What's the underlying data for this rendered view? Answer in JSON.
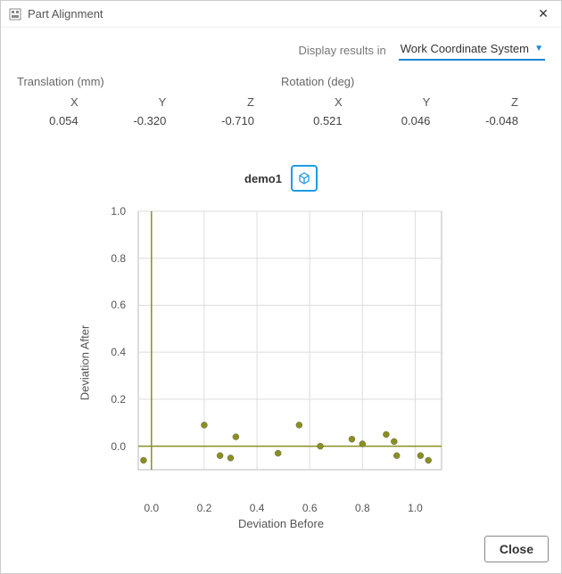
{
  "window": {
    "title": "Part Alignment"
  },
  "display": {
    "label": "Display results in",
    "selected": "Work Coordinate System"
  },
  "translation": {
    "header": "Translation (mm)",
    "x_label": "X",
    "y_label": "Y",
    "z_label": "Z",
    "x": "0.054",
    "y": "-0.320",
    "z": "-0.710"
  },
  "rotation": {
    "header": "Rotation (deg)",
    "x_label": "X",
    "y_label": "Y",
    "z_label": "Z",
    "x": "0.521",
    "y": "0.046",
    "z": "-0.048"
  },
  "legend": {
    "name": "demo1"
  },
  "footer": {
    "close": "Close"
  },
  "chart_data": {
    "type": "scatter",
    "title": "",
    "xlabel": "Deviation Before",
    "ylabel": "Deviation After",
    "xlim": [
      -0.05,
      1.1
    ],
    "ylim": [
      -0.1,
      1.0
    ],
    "xticks": [
      0.0,
      0.2,
      0.4,
      0.6,
      0.8,
      1.0
    ],
    "yticks": [
      0.0,
      0.2,
      0.4,
      0.6,
      0.8,
      1.0
    ],
    "xtick_labels": [
      "0.0",
      "0.2",
      "0.4",
      "0.6",
      "0.8",
      "1.0"
    ],
    "ytick_labels": [
      "0.0",
      "0.2",
      "0.4",
      "0.6",
      "0.8",
      "1.0"
    ],
    "reference_lines": {
      "x": 0.0,
      "y": 0.0
    },
    "series": [
      {
        "name": "demo1",
        "color": "#8a8f1f",
        "points": [
          {
            "x": -0.03,
            "y": -0.06
          },
          {
            "x": 0.2,
            "y": 0.09
          },
          {
            "x": 0.26,
            "y": -0.04
          },
          {
            "x": 0.3,
            "y": -0.05
          },
          {
            "x": 0.32,
            "y": 0.04
          },
          {
            "x": 0.48,
            "y": -0.03
          },
          {
            "x": 0.56,
            "y": 0.09
          },
          {
            "x": 0.64,
            "y": 0.0
          },
          {
            "x": 0.76,
            "y": 0.03
          },
          {
            "x": 0.8,
            "y": 0.01
          },
          {
            "x": 0.89,
            "y": 0.05
          },
          {
            "x": 0.92,
            "y": 0.02
          },
          {
            "x": 0.93,
            "y": -0.04
          },
          {
            "x": 1.02,
            "y": -0.04
          },
          {
            "x": 1.05,
            "y": -0.06
          }
        ]
      }
    ]
  }
}
